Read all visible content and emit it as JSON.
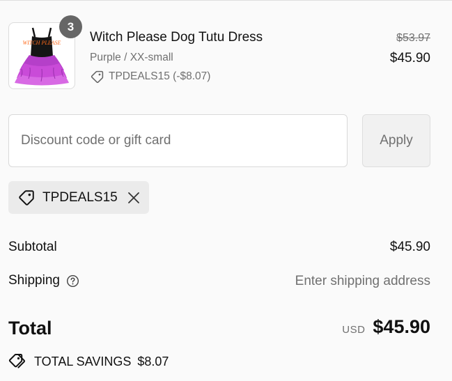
{
  "line_item": {
    "quantity": "3",
    "title": "Witch Please Dog Tutu Dress",
    "variant": "Purple / XX-small",
    "discount": "TPDEALS15 (-$8.07)",
    "original_price": "$53.97",
    "price": "$45.90",
    "image_text": "WITCH PLEASE",
    "colors": {
      "tutu": "#c94bd8",
      "top": "#151515"
    }
  },
  "discount_form": {
    "placeholder": "Discount code or gift card",
    "apply_label": "Apply"
  },
  "applied_code": {
    "label": "TPDEALS15"
  },
  "summary": {
    "subtotal_label": "Subtotal",
    "subtotal_value": "$45.90",
    "shipping_label": "Shipping",
    "shipping_value": "Enter shipping address",
    "total_label": "Total",
    "currency": "USD",
    "total_value": "$45.90",
    "savings_label": "TOTAL SAVINGS",
    "savings_value": "$8.07"
  },
  "icons": [
    "tag-icon",
    "close-icon",
    "help-circle-icon",
    "tags-icon"
  ]
}
